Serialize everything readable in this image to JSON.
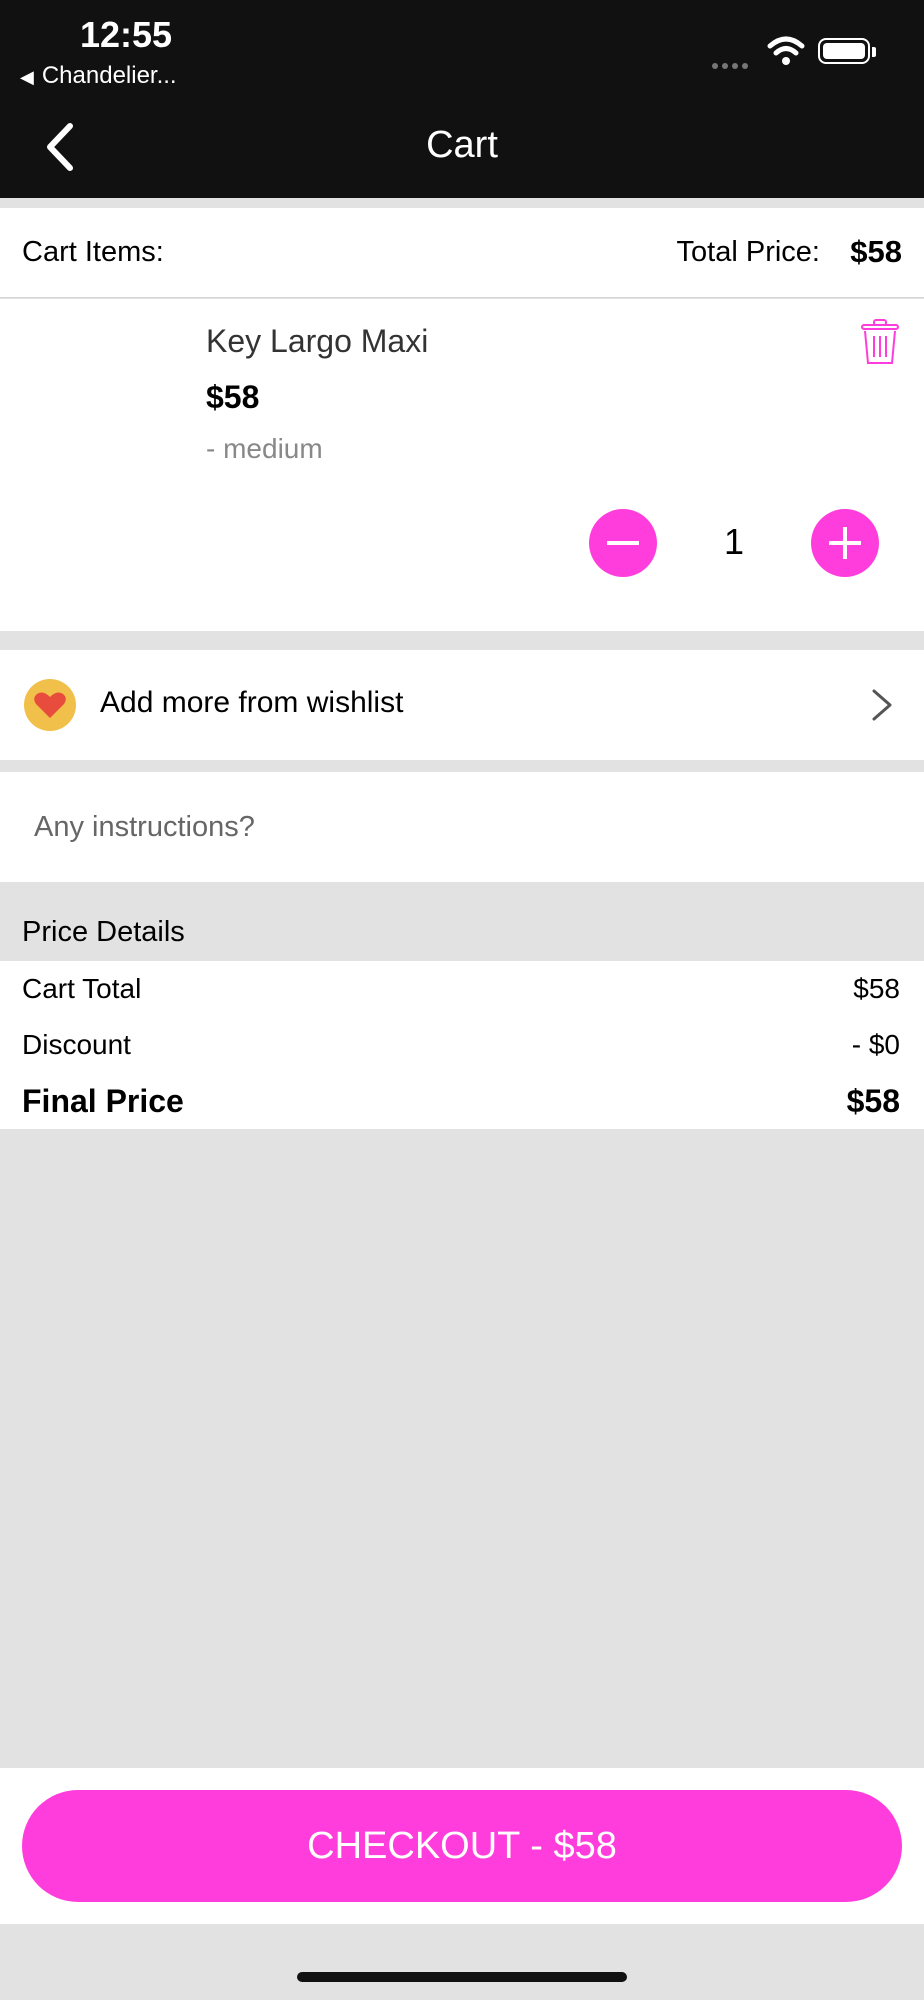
{
  "status_bar": {
    "time": "12:55",
    "back_app": "Chandelier..."
  },
  "nav": {
    "title": "Cart"
  },
  "cart_header": {
    "items_label": "Cart Items:",
    "total_label": "Total Price:",
    "total_value": "$58"
  },
  "item": {
    "name": "Key Largo Maxi",
    "price": "$58",
    "variant": "- medium",
    "quantity": "1"
  },
  "wishlist": {
    "label": "Add more from wishlist"
  },
  "instructions": {
    "placeholder": "Any instructions?",
    "value": ""
  },
  "price_details": {
    "title": "Price Details",
    "rows": [
      {
        "label": "Cart Total",
        "value": "$58"
      },
      {
        "label": "Discount",
        "value": "- $0"
      },
      {
        "label": "Final Price",
        "value": "$58"
      }
    ]
  },
  "checkout": {
    "label": "CHECKOUT - $58"
  },
  "colors": {
    "accent": "#ff3ddc",
    "header_bg": "#111111",
    "page_bg": "#e2e2e2",
    "wishlist_badge": "#f0c04a",
    "heart": "#e74c3c"
  }
}
